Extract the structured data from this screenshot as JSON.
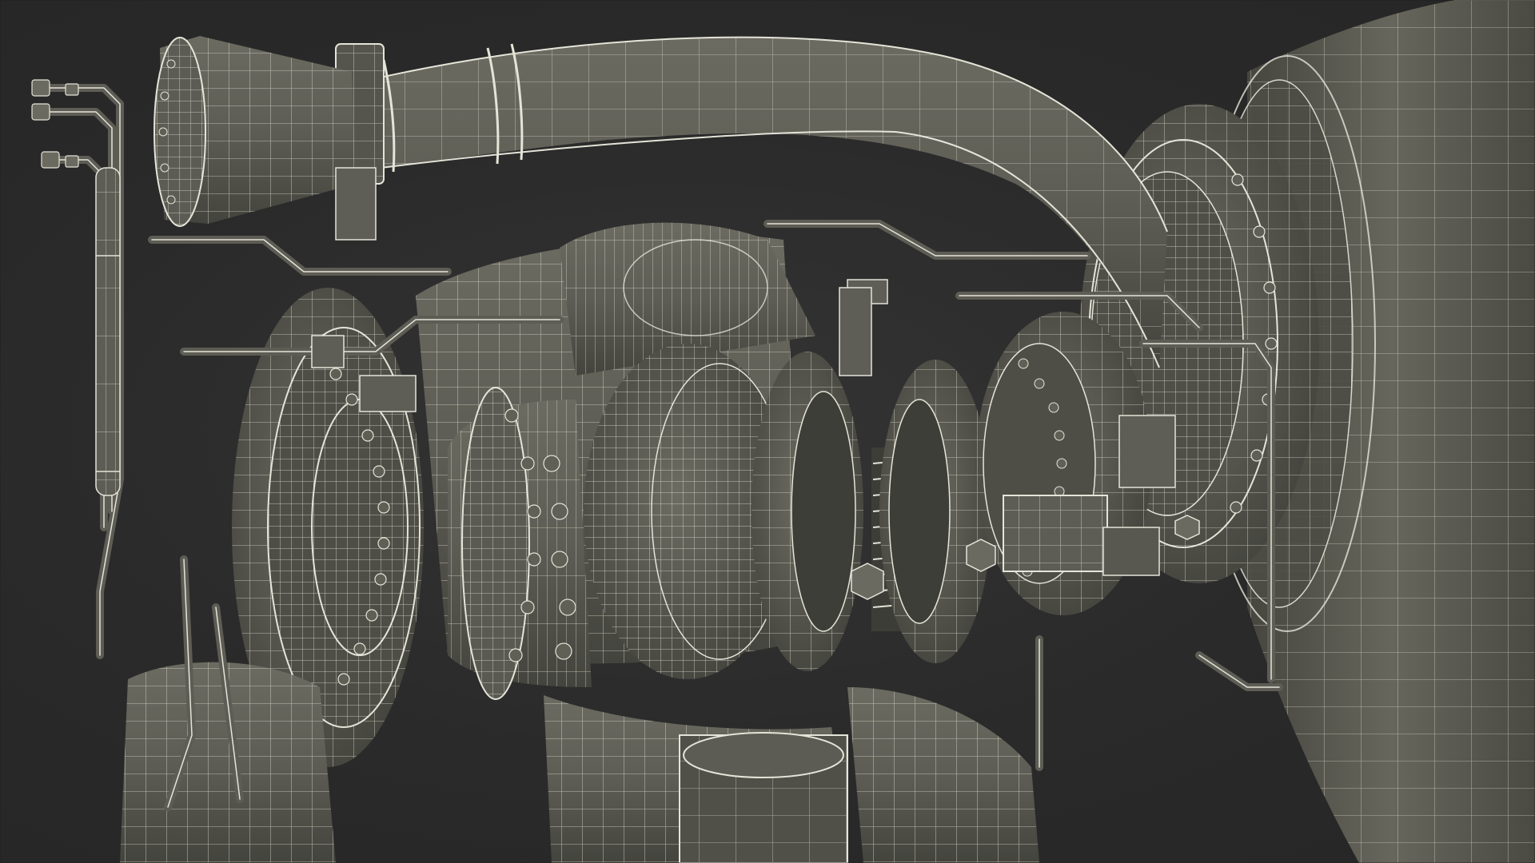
{
  "scene": {
    "subject": "rocket-engine-wireframe",
    "colors": {
      "background": "#2b2b2b",
      "shell": "#5a5a52",
      "shell_light": "#6a6a60",
      "shell_dark": "#45453f",
      "wire": "#e4e4d8",
      "shadow": "#1e1e1c"
    }
  }
}
